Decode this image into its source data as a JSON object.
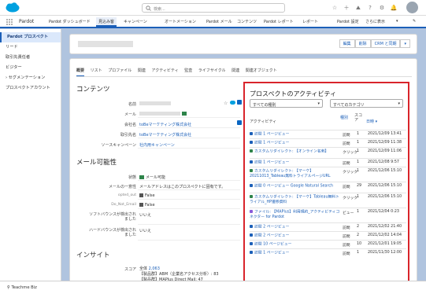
{
  "topbar": {
    "search_placeholder": "検索...",
    "icons": [
      "star-icon",
      "plus-icon",
      "help-icon",
      "gear-icon",
      "bell-icon"
    ]
  },
  "nav": {
    "app": "Pardot",
    "items": [
      "Pardot ダッシュボード",
      "見込み客",
      "キャンペーン",
      "オートメーション",
      "Pardot メール",
      "コンテンツ",
      "Pardot レポート",
      "レポート",
      "Pardot 設定",
      "さらに表示"
    ]
  },
  "sidebar": {
    "items": [
      "Pardot プロスペクト",
      "リード",
      "取引先責任者",
      "ビジター",
      "セグメンテーション",
      "プロスペクトアカウント"
    ]
  },
  "header": {
    "buttons": [
      "編集",
      "削除",
      "CRM と同期"
    ]
  },
  "tabs": [
    "概要",
    "リスト",
    "プロファイル",
    "関連",
    "アクティビティ",
    "監査",
    "ライフサイクル",
    "関連",
    "関連オブジェクト"
  ],
  "contents": {
    "title": "コンテンツ",
    "fields": [
      {
        "k": "名前",
        "v": ""
      },
      {
        "k": "メール",
        "v": ""
      },
      {
        "k": "会社名",
        "v": "toBeマーケティング株式会社"
      },
      {
        "k": "取引先名",
        "v": "toBeマーケティング株式会社"
      },
      {
        "k": "ソースキャンペーン",
        "v": "社内用キャンペーン"
      }
    ]
  },
  "mail": {
    "title": "メール可能性",
    "status_label": "状態",
    "status_value": "メール可能",
    "uniq_label": "メールの一意性",
    "uniq_value": "メールアドレスはこのプロスペクトに固有です。",
    "opted_label": "opted_out",
    "opted_value": "False",
    "dnd_label": "Do_Not_Email",
    "dnd_value": "False",
    "soft_label": "ソフトバウンスが検出されました",
    "soft_value": "いいえ",
    "hard_label": "ハードバウンスが検出されました",
    "hard_value": "いいえ"
  },
  "insight": {
    "title": "インサイト",
    "score_label": "スコア",
    "score_prefix": "全体",
    "score_value": "2,063",
    "line1": "【製品群】ABM（企業名アクセス分析）: 83",
    "line2": "【製品群】MAPlus Direct Mail: 47"
  },
  "activity": {
    "title": "プロスペクトのアクティビティ",
    "filter1": "すべての種別",
    "filter2": "すべてのカテゴリ",
    "col1": "アクティビティ",
    "col2": "種別",
    "col3": "スコア",
    "col4": "日時",
    "rows": [
      {
        "name": "訪問 1 ページビュー",
        "type": "訪問",
        "score": "1",
        "date": "2021/12/09 13:41",
        "color": "#1b5fb8"
      },
      {
        "name": "訪問 1 ページビュー",
        "type": "訪問",
        "score": "1",
        "date": "2021/12/09 11:38",
        "color": "#1b5fb8"
      },
      {
        "name": "カスタムリダイレクト: 【オンライン名刺】",
        "type": "クリック",
        "score": "1",
        "date": "2021/12/09 11:06",
        "color": "#2e844a"
      },
      {
        "name": "訪問 1 ページビュー",
        "type": "訪問",
        "score": "1",
        "date": "2021/12/08 9:57",
        "color": "#1b5fb8"
      },
      {
        "name": "カスタムリダイレクト: 【マーケ】20211013_Tableau無料トライアルページURL",
        "type": "クリック",
        "score": "1",
        "date": "2021/12/06 15:10",
        "color": "#2e844a"
      },
      {
        "name": "訪問 0 ページビュー Google Natural Search",
        "type": "訪問",
        "score": "29",
        "date": "2021/12/06 15:10",
        "color": "#1b5fb8"
      },
      {
        "name": "カスタムリダイレクト: 【マーケ】Tableau無料トライアル_HP遷移資料",
        "type": "クリック",
        "score": "1",
        "date": "2021/12/06 15:10",
        "color": "#2e844a"
      },
      {
        "name": "ファイル: 【MAPlus】利用規約_アクティビティコネクター for Pardot",
        "type": "ビュー",
        "score": "1",
        "date": "2021/12/04 0:23",
        "color": "#8a5ad8"
      },
      {
        "name": "訪問 2 ページビュー",
        "type": "訪問",
        "score": "2",
        "date": "2021/12/02 21:40",
        "color": "#1b5fb8"
      },
      {
        "name": "訪問 2 ページビュー",
        "type": "訪問",
        "score": "2",
        "date": "2021/12/02 14:04",
        "color": "#1b5fb8"
      },
      {
        "name": "訪問 10 ページビュー",
        "type": "訪問",
        "score": "10",
        "date": "2021/12/01 19:05",
        "color": "#1b5fb8"
      },
      {
        "name": "訪問 1 ページビュー",
        "type": "訪問",
        "score": "1",
        "date": "2021/11/30 12:00",
        "color": "#1b5fb8"
      }
    ]
  },
  "footer": {
    "label": "Teachme Biz"
  }
}
